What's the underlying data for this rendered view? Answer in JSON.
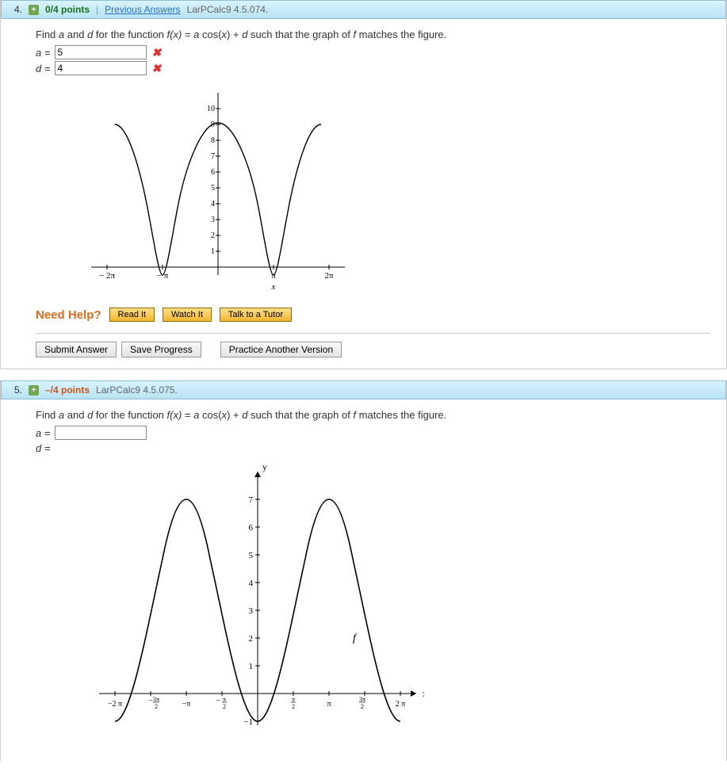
{
  "q4": {
    "number": "4.",
    "points": "0/4 points",
    "sep": "|",
    "prev": "Previous Answers",
    "ref": "LarPCalc9 4.5.074.",
    "prompt_pre": "Find ",
    "prompt_a": "a",
    "prompt_and": " and ",
    "prompt_d": "d",
    "prompt_mid": " for the function ",
    "prompt_fx": "f(x)",
    "prompt_eq": " = ",
    "prompt_a2": "a",
    "prompt_cos": " cos(",
    "prompt_x": "x",
    "prompt_close": ") + ",
    "prompt_d2": "d",
    "prompt_post": " such that the graph of ",
    "prompt_f": "f",
    "prompt_end": " matches the figure.",
    "row_a_label": "a =",
    "row_a_value": "5",
    "row_d_label": "d =",
    "row_d_value": "4",
    "needhelp": "Need Help?",
    "readit": "Read It",
    "watchit": "Watch It",
    "talktutor": "Talk to a Tutor",
    "submit": "Submit Answer",
    "saveprog": "Save Progress",
    "pracver": "Practice Another Version"
  },
  "q5": {
    "number": "5.",
    "points": "–/4 points",
    "ref": "LarPCalc9 4.5.075.",
    "prompt_pre": "Find ",
    "prompt_a": "a",
    "prompt_and": " and ",
    "prompt_d": "d",
    "prompt_mid": " for the function  ",
    "prompt_fx": "f(x)",
    "prompt_eq": " = ",
    "prompt_a2": "a",
    "prompt_cos": " cos(",
    "prompt_x": "x",
    "prompt_close": ") + ",
    "prompt_d2": "d",
    "prompt_post": "  such that the graph of ",
    "prompt_f": "f",
    "prompt_end": " matches the figure.",
    "row_a_label": "a =",
    "row_d_label": "d ="
  },
  "chart_data": [
    {
      "id": "q4_graph",
      "type": "line",
      "title": "",
      "xlabel": "x",
      "ylabel": "",
      "xticks": [
        "-2π",
        "-π",
        "π",
        "2π"
      ],
      "yticks": [
        1,
        2,
        3,
        4,
        5,
        6,
        7,
        8,
        9,
        10
      ],
      "ylim": [
        0,
        10
      ],
      "xlim": [
        -6.6,
        6.6
      ],
      "series": [
        {
          "name": "f",
          "function": "5*cos(x)+4? (displayed W shape peaking ~9 at x=0 dipping to ~0 at x=±π; actually two humps around 0)",
          "approx_points": [
            [
              -6.28,
              9
            ],
            [
              -3.14,
              -1
            ],
            [
              0,
              9
            ],
            [
              3.14,
              -1
            ],
            [
              6.28,
              9
            ]
          ]
        }
      ],
      "note": "Graph visually peaks near 9 at x=-2π,0,2π and dips near -1 at x=-π,π (shown as W shape truncated near y=0)."
    },
    {
      "id": "q5_graph",
      "type": "line",
      "title": "",
      "xlabel": "x",
      "ylabel": "y",
      "xticks": [
        "-2π",
        "-3π/2",
        "-π",
        "-π/2",
        "π/2",
        "π",
        "3π/2",
        "2π"
      ],
      "yticks": [
        -1,
        1,
        2,
        3,
        4,
        5,
        6,
        7
      ],
      "ylim": [
        -1,
        7
      ],
      "xlim": [
        -6.6,
        6.6
      ],
      "series": [
        {
          "name": "f",
          "function": "-4*cos(x)+3",
          "approx_points": [
            [
              -6.28,
              -1
            ],
            [
              -3.14,
              7
            ],
            [
              0,
              -1
            ],
            [
              3.14,
              7
            ],
            [
              6.28,
              -1
            ]
          ]
        }
      ],
      "annotation_f_at": [
        3.5,
        2
      ]
    }
  ]
}
